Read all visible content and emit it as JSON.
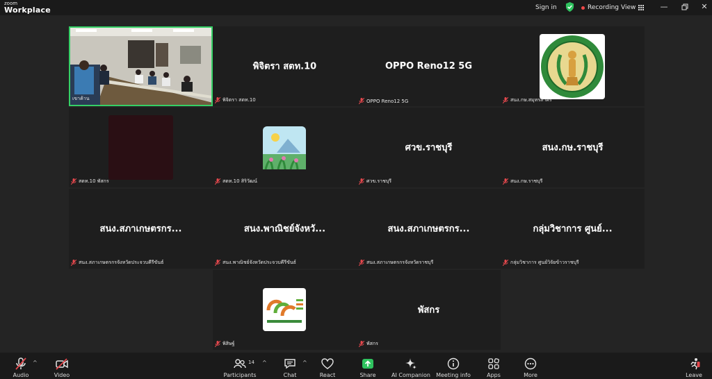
{
  "app": {
    "brand_small": "zoom",
    "brand_name": "Workplace"
  },
  "titlebar": {
    "signin": "Sign in",
    "recording": "Recording",
    "view": "View"
  },
  "tiles": [
    {
      "center": "",
      "footer": "เขาค้าน",
      "type": "camera"
    },
    {
      "center": "พิจิตรา สตท.10",
      "footer": "พิจิตรา สตท.10",
      "type": "name"
    },
    {
      "center": "OPPO Reno12 5G",
      "footer": "OPPO Reno12 5G",
      "type": "name"
    },
    {
      "center": "",
      "footer": "สนง.กษ.สมุทรสาคร",
      "type": "seal"
    },
    {
      "center": "",
      "footer": "สตท.10 พัสกร",
      "type": "dark"
    },
    {
      "center": "",
      "footer": "สตท.10 สิริวัฒน์",
      "type": "landscape"
    },
    {
      "center": "ศวข.ราชบุรี",
      "footer": "ศวข.ราชบุรี",
      "type": "name"
    },
    {
      "center": "สนง.กษ.ราชบุรี",
      "footer": "สนง.กษ.ราชบุรี",
      "type": "name"
    },
    {
      "center": "สนง.สภาเกษตรกร...",
      "footer": "สนง.สภาเกษตรกรจังหวัดประจวบคีรีขันธ์",
      "type": "name"
    },
    {
      "center": "สนง.พาณิชย์จังหวั...",
      "footer": "สนง.พาณิชย์จังหวัดประจวบคีรีขันธ์",
      "type": "name"
    },
    {
      "center": "สนง.สภาเกษตรกร...",
      "footer": "สนง.สภาเกษตรกรจังหวัดราชบุรี",
      "type": "name"
    },
    {
      "center": "กลุ่มวิชาการ ศูนย์...",
      "footer": "กลุ่มวิชาการ ศูนย์วิจัยข้าวราชบุรี",
      "type": "name"
    },
    {
      "center": "",
      "footer": "พิสิษฐ์",
      "type": "logo"
    },
    {
      "center": "พัสกร",
      "footer": "พัสกร",
      "type": "name"
    }
  ],
  "toolbar": {
    "audio": "Audio",
    "video": "Video",
    "participants": "Participants",
    "participant_count": "14",
    "chat": "Chat",
    "react": "React",
    "share": "Share",
    "ai_companion": "AI Companion",
    "meeting_info": "Meeting info",
    "apps": "Apps",
    "more": "More",
    "leave": "Leave"
  },
  "colors": {
    "active_speaker": "#35d066",
    "share_green": "#2fc35f",
    "muted_red": "#e5484d",
    "background": "#242424"
  },
  "icons": [
    "shield-check-icon",
    "grid-icon",
    "minimize-icon",
    "restore-icon",
    "close-icon",
    "mic-off-icon",
    "video-off-icon",
    "participants-icon",
    "chat-icon",
    "heart-icon",
    "share-arrow-icon",
    "sparkle-icon",
    "info-icon",
    "apps-icon",
    "more-icon",
    "leave-icon"
  ]
}
